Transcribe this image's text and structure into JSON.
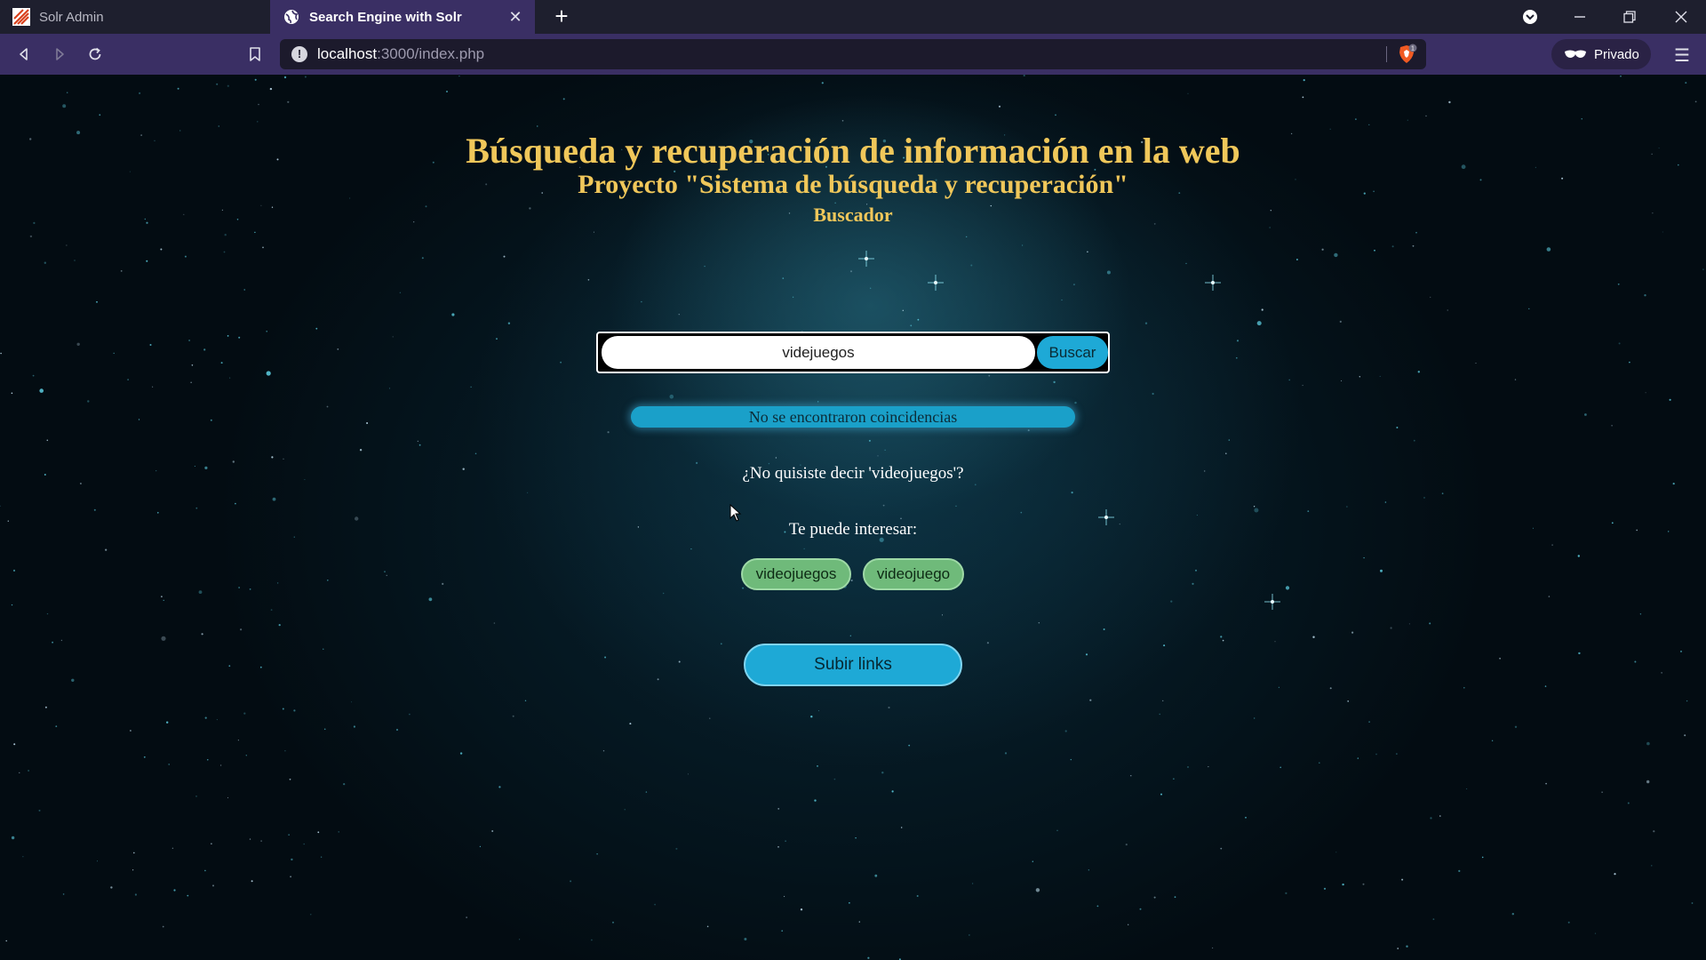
{
  "browser": {
    "tabs": [
      {
        "title": "Solr Admin",
        "active": false
      },
      {
        "title": "Search Engine with Solr",
        "active": true
      }
    ],
    "new_tab_symbol": "+",
    "url_host": "localhost",
    "url_rest": ":3000/index.php",
    "private_label": "Privado",
    "brave_badge": "1"
  },
  "page": {
    "title": "Búsqueda y recuperación de información en la web",
    "subtitle": "Proyecto \"Sistema de búsqueda y recuperación\"",
    "section": "Buscador",
    "search": {
      "value": "videjuegos",
      "button_label": "Buscar"
    },
    "no_results": "No se encontraron coincidencias",
    "did_you_mean": "¿No quisiste decir 'videojuegos'?",
    "interest_label": "Te puede interesar:",
    "suggestions": [
      {
        "label": "videojuegos"
      },
      {
        "label": "videojuego"
      }
    ],
    "upload_label": "Subir links"
  },
  "colors": {
    "heading": "#f0c75a",
    "accent": "#1ea9d6",
    "chip": "#6fba7a",
    "chrome": "#3a2f64"
  }
}
